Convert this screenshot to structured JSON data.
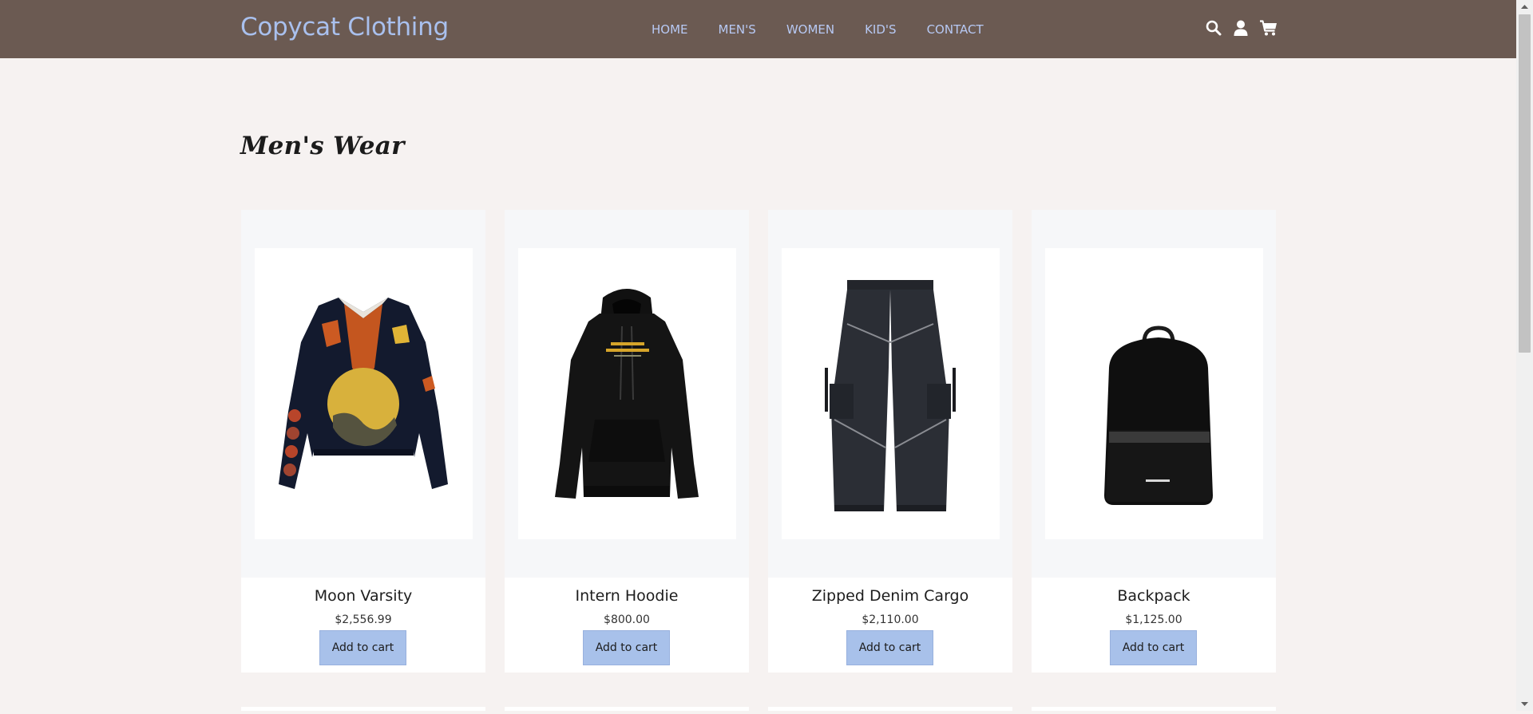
{
  "brand": {
    "name": "Copycat Clothing"
  },
  "nav": {
    "links": [
      "HOME",
      "MEN'S",
      "WOMEN",
      "KID'S",
      "CONTACT"
    ],
    "icons": [
      "search-icon",
      "user-icon",
      "cart-icon"
    ]
  },
  "page": {
    "title": "Men's Wear"
  },
  "products": [
    {
      "name": "Moon Varsity",
      "price": "$2,556.99",
      "button": "Add to cart",
      "image": "varsity-cardigan"
    },
    {
      "name": "Intern Hoodie",
      "price": "$800.00",
      "button": "Add to cart",
      "image": "black-hoodie"
    },
    {
      "name": "Zipped Denim Cargo",
      "price": "$2,110.00",
      "button": "Add to cart",
      "image": "denim-cargo-pants"
    },
    {
      "name": "Backpack",
      "price": "$1,125.00",
      "button": "Add to cart",
      "image": "black-backpack"
    }
  ],
  "colors": {
    "navbar": "#6b5a52",
    "brand": "#a9c0ee",
    "nav_link": "#b7c9f4",
    "page_bg": "#f6f2f1",
    "button": "#a8c1ea"
  }
}
